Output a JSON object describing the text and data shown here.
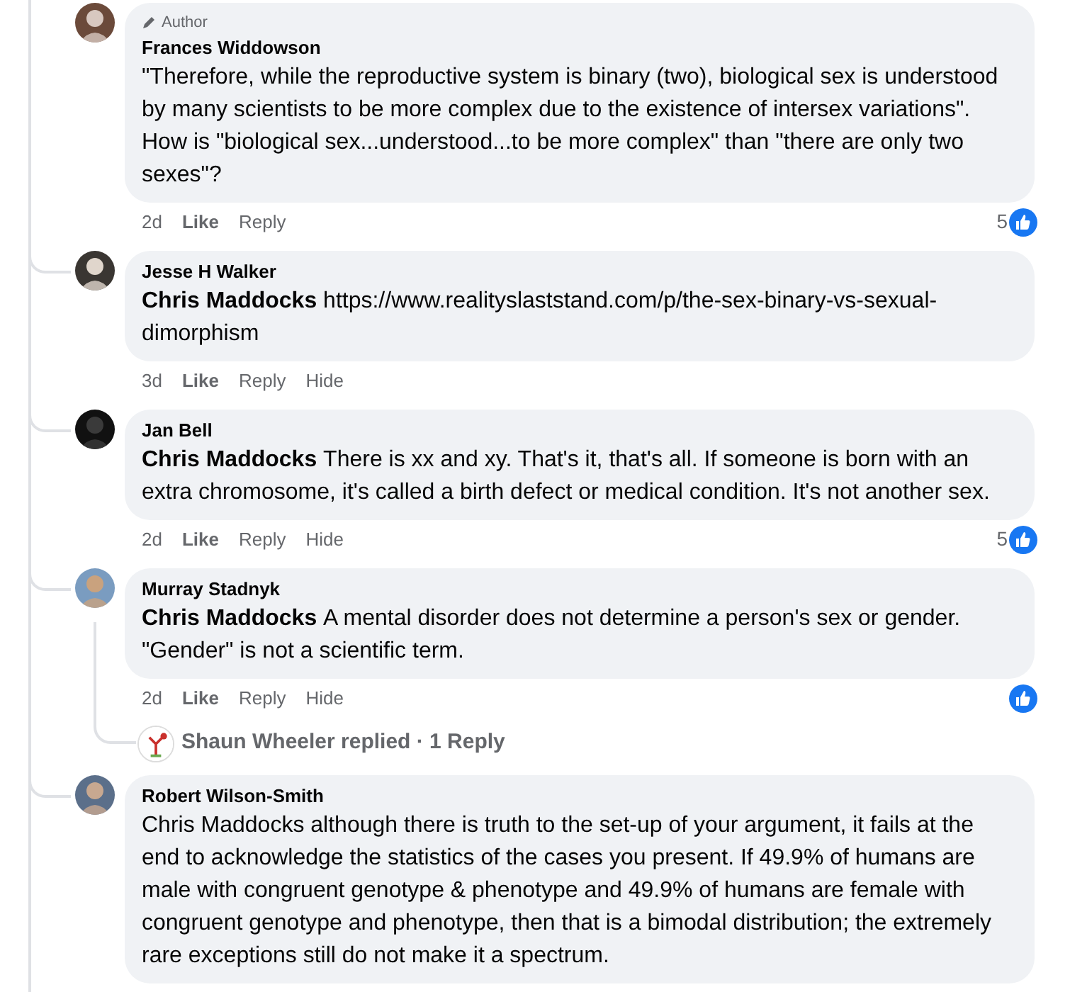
{
  "comments": [
    {
      "author": "Frances Widdowson",
      "badge": "Author",
      "text": "\"Therefore, while the reproductive system is binary (two), biological sex is understood by many scientists to be more complex due to the existence of intersex variations\". How is \"biological sex...understood...to be more complex\" than \"there are only two sexes\"?",
      "time": "2d",
      "actions": [
        "Like",
        "Reply"
      ],
      "reacted": true,
      "reaction_count": "5"
    },
    {
      "author": "Jesse H Walker",
      "mention": "Chris Maddocks",
      "text": "https://www.realityslaststand.com/p/the-sex-binary-vs-sexual-dimorphism",
      "time": "3d",
      "actions": [
        "Like",
        "Reply",
        "Hide"
      ],
      "reacted": false
    },
    {
      "author": "Jan Bell",
      "mention": "Chris Maddocks",
      "text": "There is xx and xy. That's it, that's all. If someone is born with an extra chromosome, it's called a birth defect or medical condition. It's not another sex.",
      "time": "2d",
      "actions": [
        "Like",
        "Reply",
        "Hide"
      ],
      "reacted": true,
      "reaction_count": "5"
    },
    {
      "author": "Murray Stadnyk",
      "mention": "Chris Maddocks",
      "text": "A mental disorder does not determine a person's sex or gender. \"Gender\" is not a scientific term.",
      "time": "2d",
      "actions": [
        "Like",
        "Reply",
        "Hide"
      ],
      "reacted": true,
      "replies": "Shaun Wheeler replied · 1 Reply"
    },
    {
      "author": "Robert Wilson-Smith",
      "text": "Chris Maddocks although there is truth to the set-up of your argument, it fails at the end to acknowledge the statistics of the cases you present. If 49.9% of humans are male with congruent genotype & phenotype and 49.9% of humans are female with congruent genotype and phenotype, then that is a bimodal distribution; the extremely rare exceptions still do not make it a spectrum.",
      "reacted": false
    }
  ]
}
